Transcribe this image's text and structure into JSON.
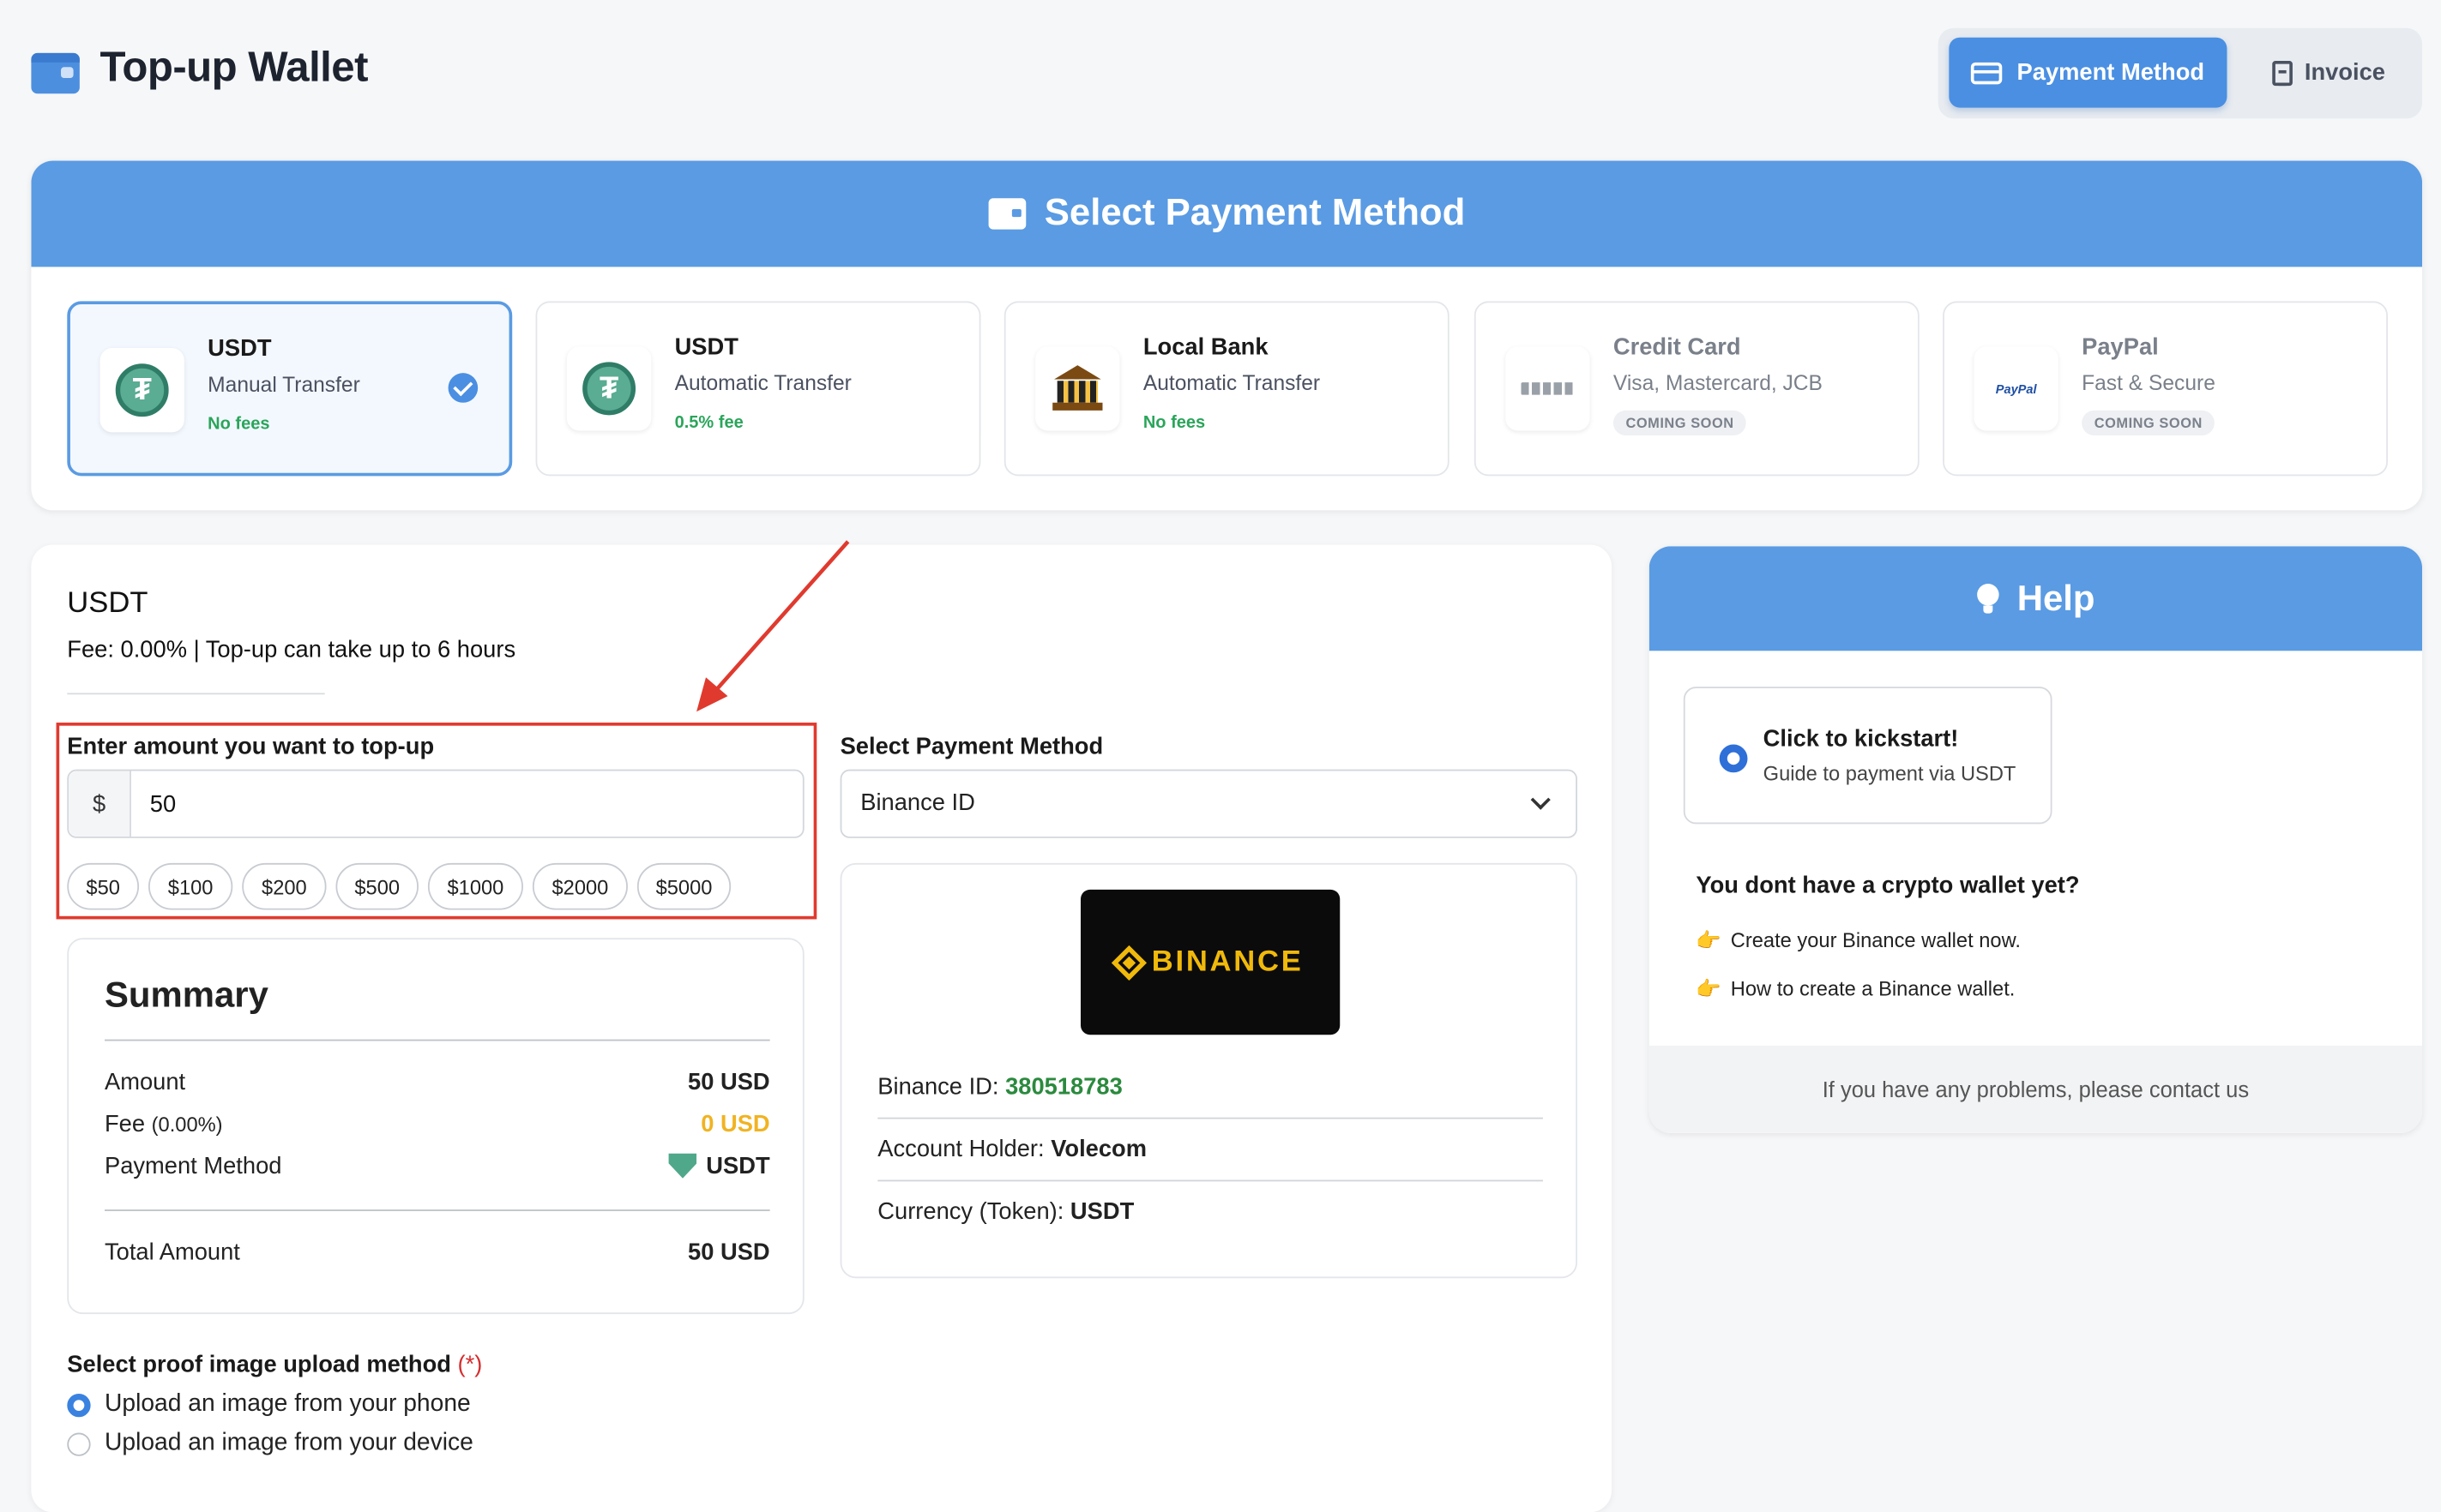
{
  "header": {
    "title": "Top-up Wallet",
    "tabs": [
      {
        "label": "Payment Method",
        "active": true,
        "icon": "credit-card-icon"
      },
      {
        "label": "Invoice",
        "active": false,
        "icon": "document-icon"
      }
    ]
  },
  "payment_panel": {
    "title": "Select Payment Method",
    "methods": [
      {
        "name": "USDT",
        "subtitle": "Manual Transfer",
        "note": "No fees",
        "selected": true,
        "icon": "tether-icon"
      },
      {
        "name": "USDT",
        "subtitle": "Automatic Transfer",
        "note": "0.5% fee",
        "selected": false,
        "icon": "tether-icon"
      },
      {
        "name": "Local Bank",
        "subtitle": "Automatic Transfer",
        "note": "No fees",
        "selected": false,
        "icon": "bank-icon"
      },
      {
        "name": "Credit Card",
        "subtitle": "Visa, Mastercard, JCB",
        "note": "COMING SOON",
        "selected": false,
        "icon": "credit-card-icon"
      },
      {
        "name": "PayPal",
        "subtitle": "Fast & Secure",
        "note": "COMING SOON",
        "selected": false,
        "icon": "paypal-icon",
        "logo_text": "PayPal"
      }
    ]
  },
  "main": {
    "section_title": "USDT",
    "fee_line": "Fee: 0.00% | Top-up can take up to 6 hours",
    "amount_label": "Enter amount you want to top-up",
    "currency_prefix": "$",
    "amount_value": "50",
    "quick_amounts": [
      "$50",
      "$100",
      "$200",
      "$500",
      "$1000",
      "$2000",
      "$5000"
    ],
    "method_select_label": "Select Payment Method",
    "method_select_value": "Binance ID",
    "binance": {
      "logo_text": "BINANCE",
      "id_label": "Binance ID: ",
      "id_value": "380518783",
      "holder_label": "Account Holder: ",
      "holder_value": "Volecom",
      "currency_label": "Currency (Token): ",
      "currency_value": "USDT"
    },
    "summary": {
      "title": "Summary",
      "amount_label": "Amount",
      "amount_value": "50 USD",
      "fee_label": "Fee",
      "fee_pct": "(0.00%)",
      "fee_value": "0 USD",
      "method_label": "Payment Method",
      "method_value": "USDT",
      "total_label": "Total Amount",
      "total_value": "50 USD"
    },
    "proof": {
      "label": "Select proof image upload method",
      "required_mark": "(*)",
      "options": [
        {
          "label": "Upload an image from your phone",
          "checked": true
        },
        {
          "label": "Upload an image from your device",
          "checked": false
        }
      ]
    }
  },
  "help": {
    "title": "Help",
    "kickstart_title": "Click to kickstart!",
    "kickstart_sub": "Guide to payment via USDT",
    "no_wallet": "You dont have a crypto wallet yet?",
    "links": [
      "Create your Binance wallet now.",
      "How to create a Binance wallet."
    ],
    "footer": "If you have any problems, please contact us"
  },
  "colors": {
    "accent": "#4a8fe2",
    "header_blue": "#5a9be3",
    "success_green": "#2aa55a",
    "highlight_red": "#e03a2f",
    "fee_yellow": "#f0b322"
  }
}
